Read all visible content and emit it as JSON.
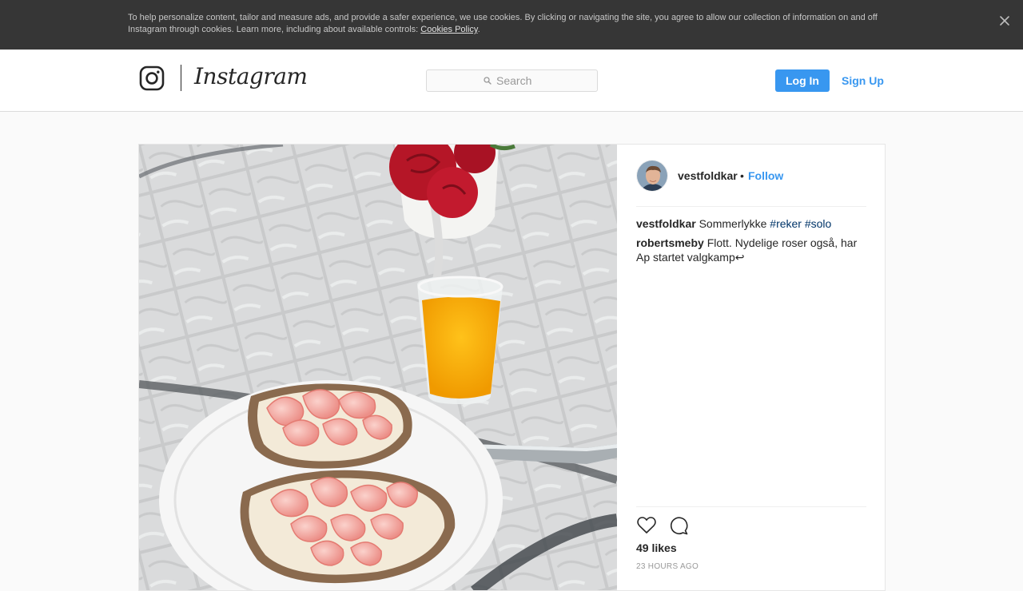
{
  "cookie_banner": {
    "text": "To help personalize content, tailor and measure ads, and provide a safer experience, we use cookies. By clicking or navigating the site, you agree to allow our collection of information on and off Instagram through cookies. Learn more, including about available controls: ",
    "link_label": "Cookies Policy",
    "trailing": ".",
    "close_icon": "close-icon"
  },
  "header": {
    "logo_icon": "instagram-camera-icon",
    "wordmark": "Instagram",
    "search": {
      "placeholder": "Search",
      "icon": "search-icon"
    },
    "login_label": "Log In",
    "signup_label": "Sign Up"
  },
  "post": {
    "author": "vestfoldkar",
    "separator": "•",
    "follow_label": "Follow",
    "caption": {
      "user": "vestfoldkar",
      "text": "Sommerlykke",
      "hashtags": [
        "#reker",
        "#solo"
      ]
    },
    "comments": [
      {
        "user": "robertsmeby",
        "text": "Flott. Nydelige roser også, har Ap startet valgkamp↩"
      }
    ],
    "actions": {
      "like_icon": "heart-icon",
      "comment_icon": "comment-bubble-icon"
    },
    "likes": "49 likes",
    "timestamp": "23 HOURS AGO"
  },
  "colors": {
    "accent": "#3897f0",
    "banner_bg": "#363636",
    "hashtag": "#003569",
    "text": "#262626",
    "muted": "#999999"
  }
}
